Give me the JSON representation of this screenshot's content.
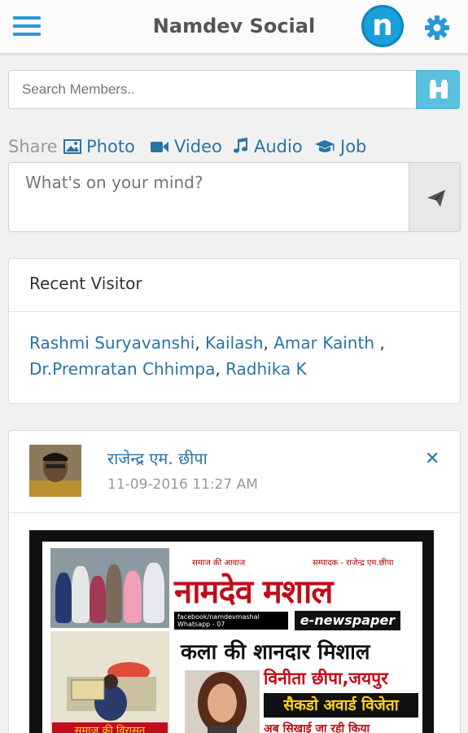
{
  "header": {
    "title": "Namdev Social",
    "logo_letter": "n",
    "menu_icon": "hamburger-menu-icon",
    "settings_icon": "gear-icon",
    "accent_color": "#2a98d6"
  },
  "search": {
    "placeholder": "Search Members..",
    "button_icon": "binoculars-icon",
    "button_color": "#5bc0de"
  },
  "share": {
    "label": "Share",
    "items": [
      {
        "label": "Photo",
        "icon": "photo-icon"
      },
      {
        "label": "Video",
        "icon": "video-camera-icon"
      },
      {
        "label": "Audio",
        "icon": "music-note-icon"
      },
      {
        "label": "Job",
        "icon": "graduation-cap-icon"
      }
    ]
  },
  "composer": {
    "placeholder": "What's on your mind?",
    "send_icon": "paper-plane-icon"
  },
  "recent_visitor": {
    "title": "Recent Visitor",
    "names": [
      "Rashmi Suryavanshi",
      "Kailash",
      "Amar Kainth",
      "Dr.Premratan Chhimpa",
      "Radhika K"
    ],
    "separator": ",",
    "separator_spaced": " ,"
  },
  "post": {
    "author": "राजेन्द्र एम. छीपा",
    "timestamp": "11-09-2016 11:27 AM",
    "close_icon": "close-icon",
    "image": {
      "tagline_left": "समाज की आवाज",
      "tagline_right": "सम्पादक - राजेन्द्र एम.छीपा",
      "masthead": "नामदेव मशाल",
      "facebook_line": "facebook/namdevmashal",
      "whatsapp_line": "Whatsapp - 07",
      "enewspaper": "e-newspaper",
      "headline": "कला की शानदार मिशाल",
      "person": "विनीता छीपा,जयपुर",
      "award": "सैकडो अवार्ड विजेता",
      "foot_left": "समाज की विरासत",
      "foot_right": "अब सिखाई जा रही किया"
    }
  }
}
